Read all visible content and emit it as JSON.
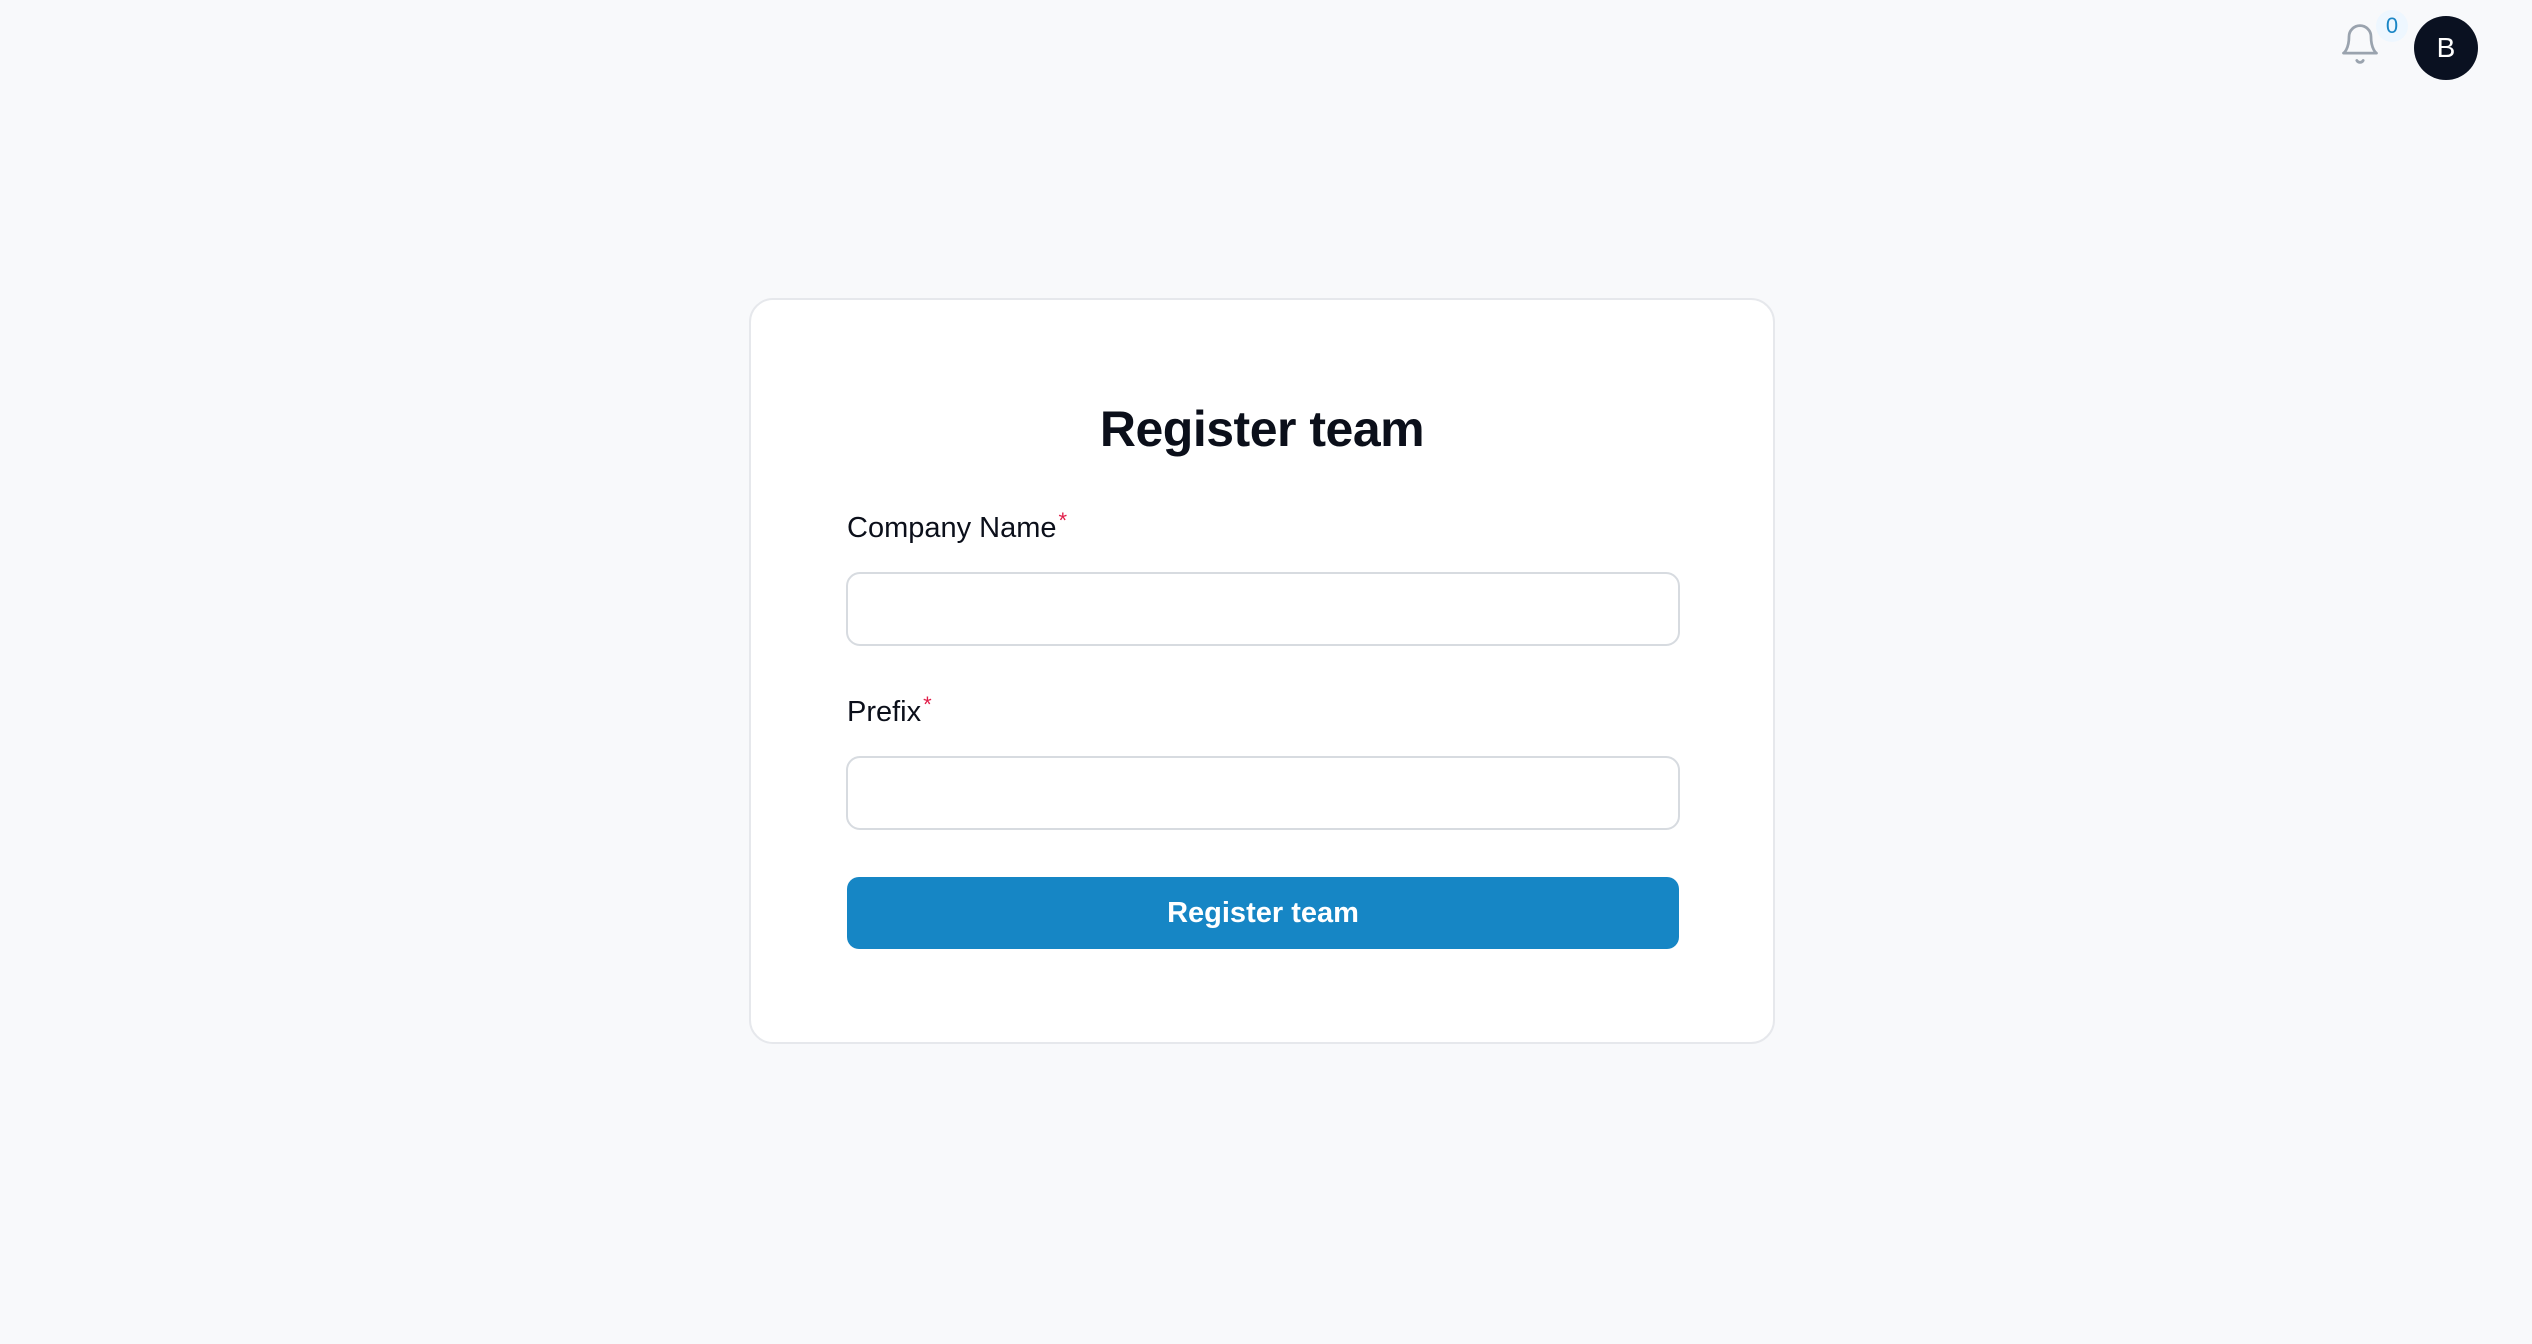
{
  "header": {
    "notifications": {
      "icon": "bell-icon",
      "count": "0"
    },
    "avatar": {
      "initial": "B",
      "background": "#0a1121"
    }
  },
  "form": {
    "title": "Register team",
    "fields": [
      {
        "label": "Company Name",
        "required_marker": "*",
        "value": "",
        "placeholder": ""
      },
      {
        "label": "Prefix",
        "required_marker": "*",
        "value": "",
        "placeholder": ""
      }
    ],
    "submit_label": "Register team"
  },
  "colors": {
    "accent": "#1686c5",
    "required": "#e11d48",
    "background": "#f8f9fb"
  }
}
